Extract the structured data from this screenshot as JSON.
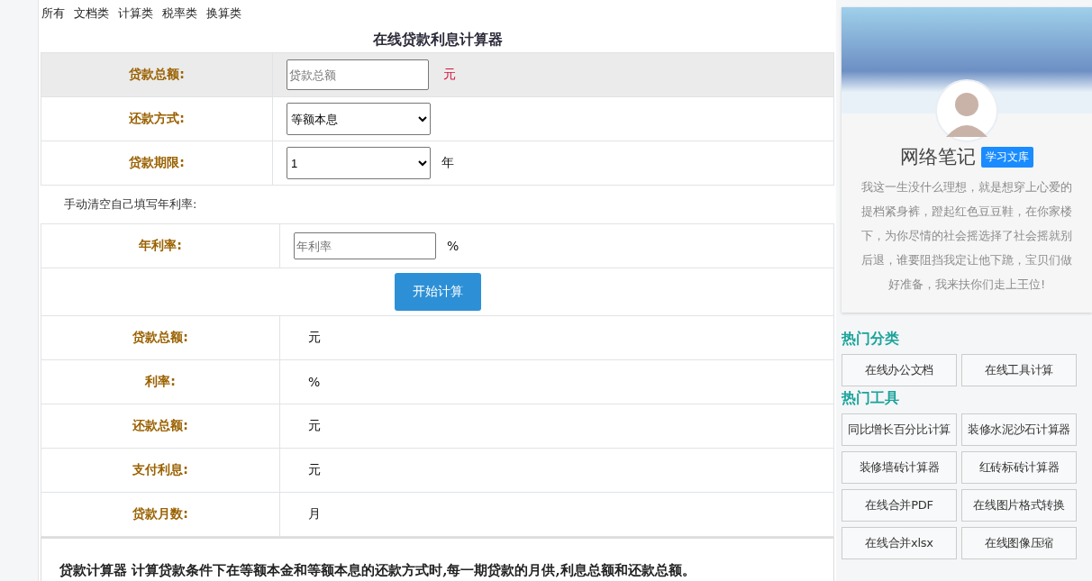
{
  "nav": [
    "所有",
    "文档类",
    "计算类",
    "税率类",
    "换算类"
  ],
  "title": "在线贷款利息计算器",
  "form": [
    {
      "kind": "input",
      "label": "贷款总额:",
      "placeholder": "贷款总额",
      "unit": "元",
      "highlighted": true
    },
    {
      "kind": "select",
      "label": "还款方式:",
      "value": "等额本息",
      "highlighted": false
    },
    {
      "kind": "select",
      "label": "贷款期限:",
      "value": "1",
      "unit": "年",
      "highlighted": false
    }
  ],
  "hint": "手动清空自己填写年利率:",
  "rate": {
    "label": "年利率:",
    "placeholder": "年利率",
    "unit": "%"
  },
  "button": "开始计算",
  "results": [
    {
      "label": "贷款总额:",
      "unit": "元"
    },
    {
      "label": "利率:",
      "unit": "%"
    },
    {
      "label": "还款总额:",
      "unit": "元"
    },
    {
      "label": "支付利息:",
      "unit": "元"
    },
    {
      "label": "贷款月数:",
      "unit": "月"
    }
  ],
  "description": "贷款计算器 计算贷款条件下在等额本金和等额本息的还款方式时,每一期贷款的月供,利息总额和还款总额。",
  "profile": {
    "name": "网络笔记",
    "badge": "学习文库",
    "bio": "我这一生没什么理想，就是想穿上心爱的提档紧身裤，蹬起红色豆豆鞋，在你家楼下，为你尽情的社会摇选择了社会摇就别后退，谁要阻挡我定让他下跪，宝贝们做好准备，我来扶你们走上王位!"
  },
  "sections": [
    {
      "title": "热门分类",
      "items": [
        "在线办公文档",
        "在线工具计算"
      ]
    },
    {
      "title": "热门工具",
      "items": [
        "同比增长百分比计算",
        "装修水泥沙石计算器",
        "装修墙砖计算器",
        "红砖标砖计算器",
        "在线合并PDF",
        "在线图片格式转换",
        "在线合并xlsx",
        "在线图像压缩"
      ]
    }
  ]
}
